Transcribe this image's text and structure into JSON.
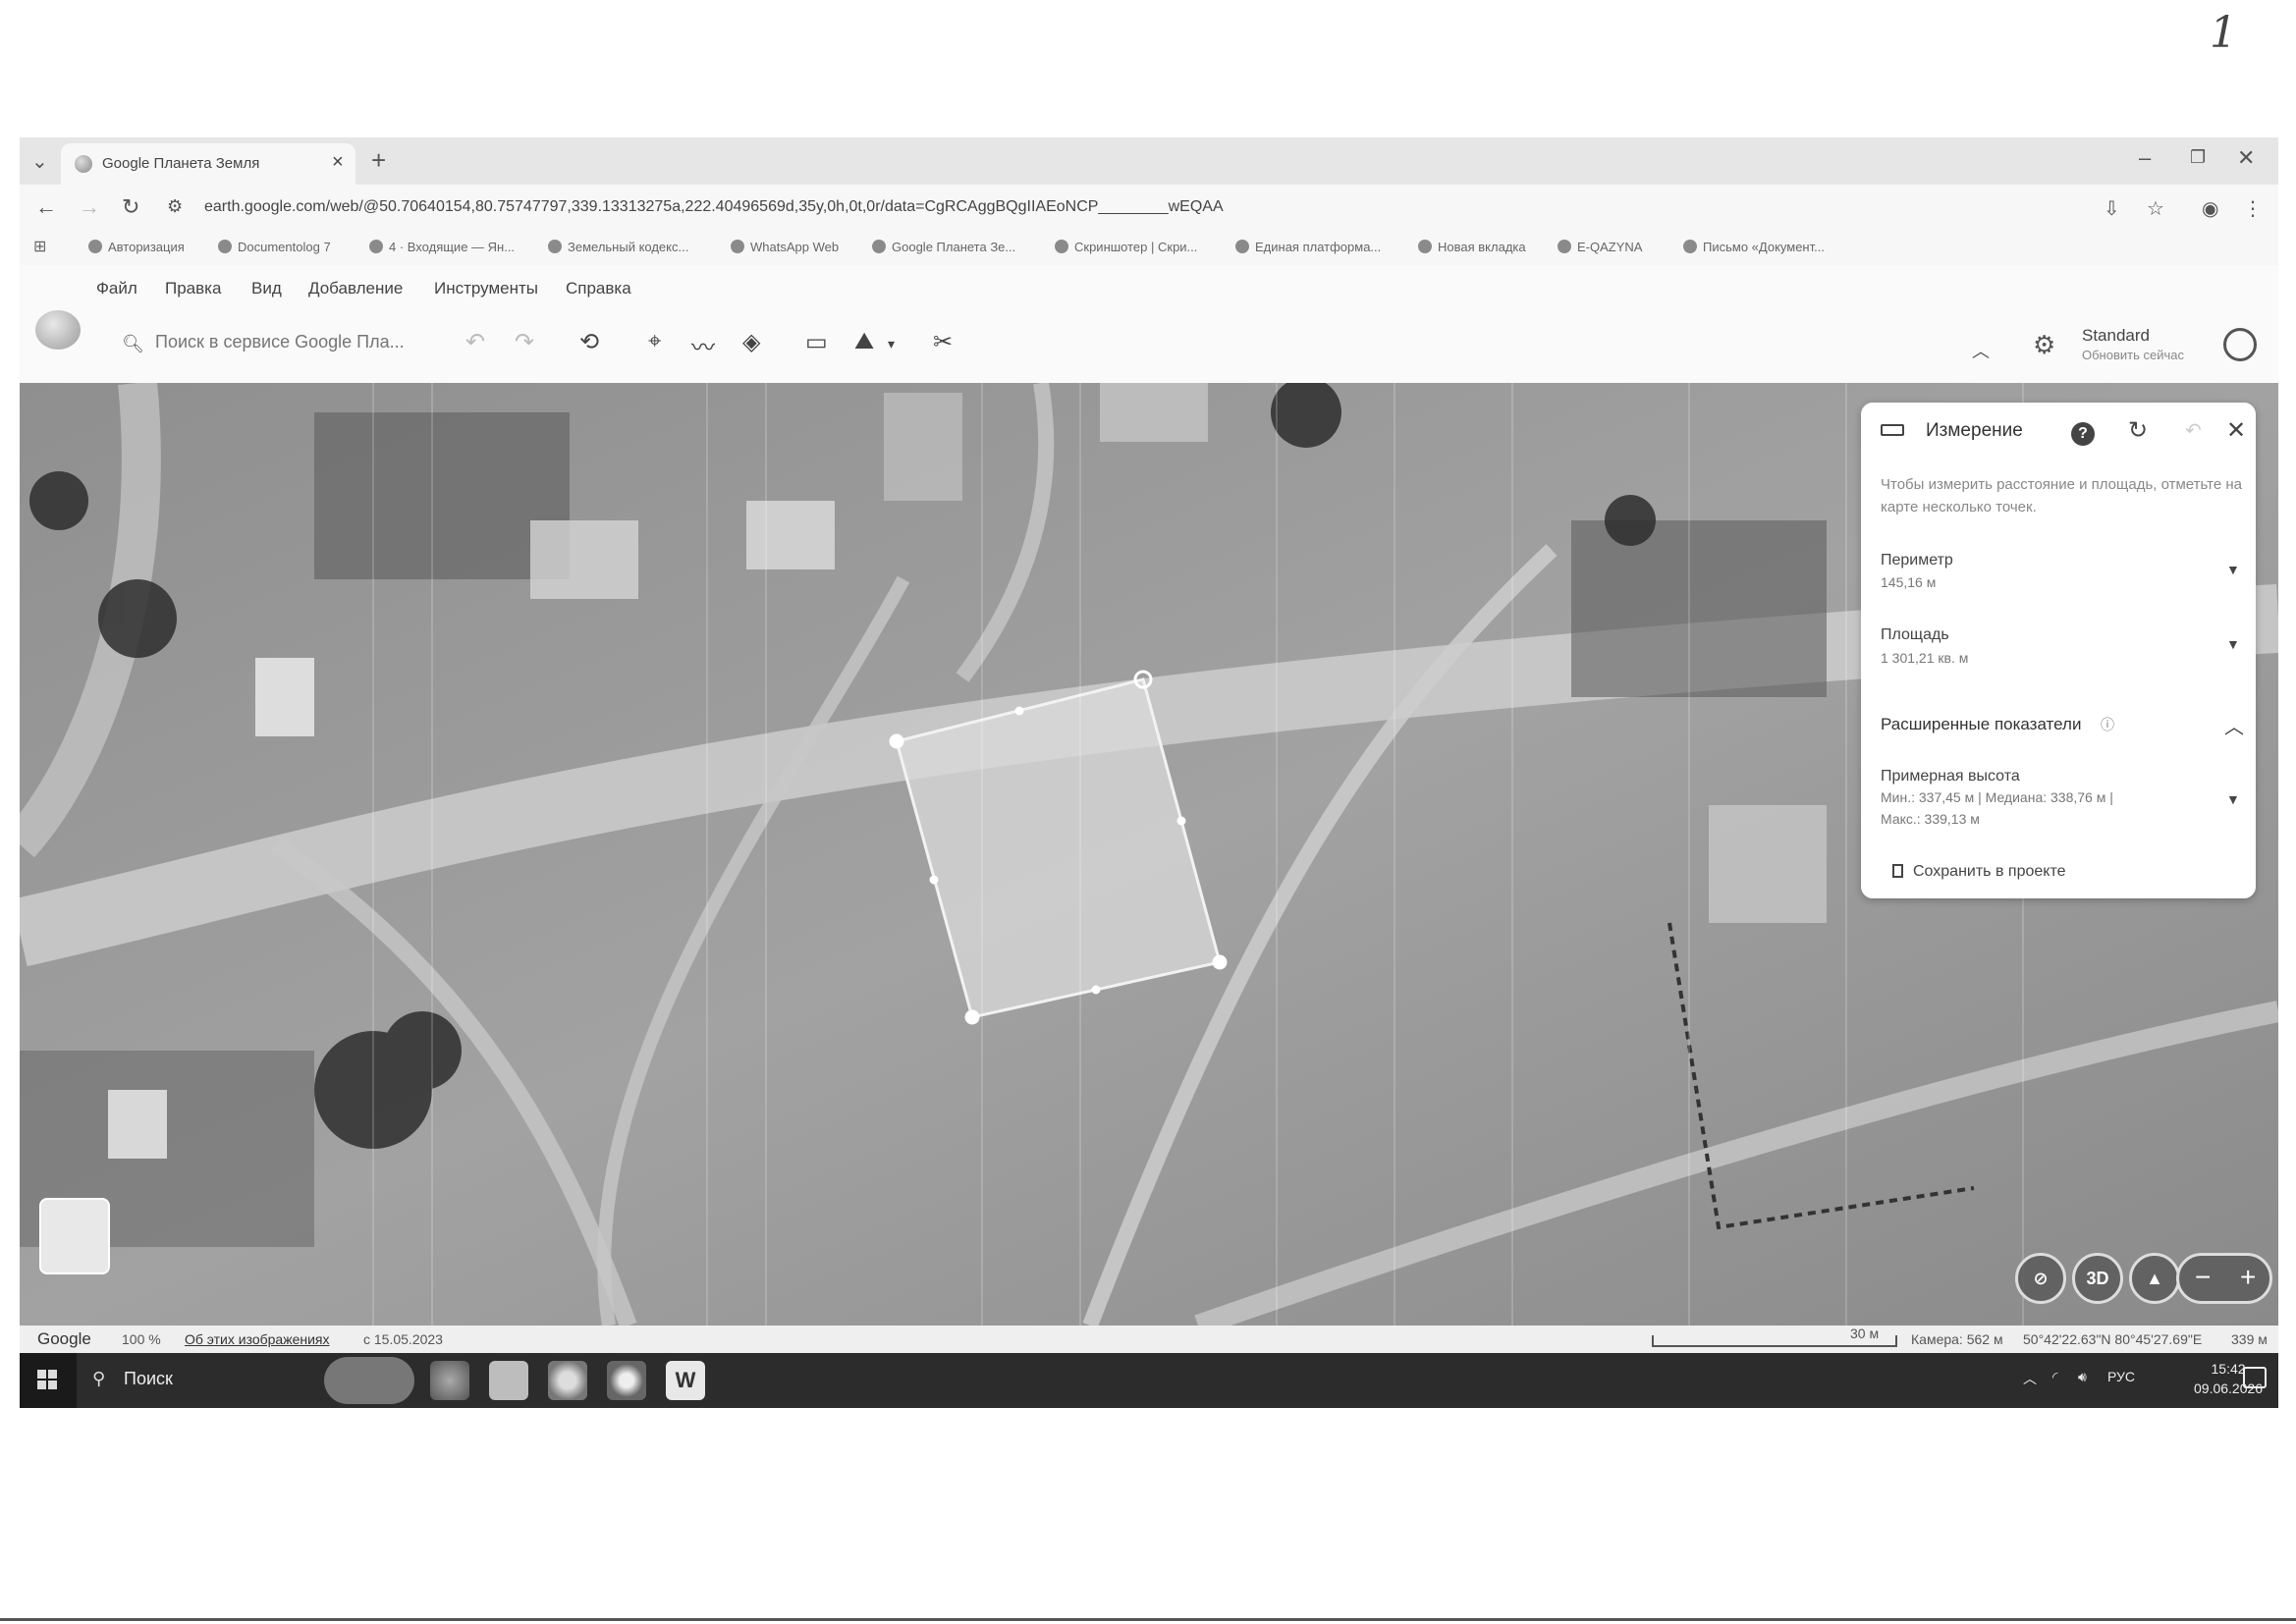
{
  "page_number": "1",
  "browser": {
    "tab_title": "Google Планета Земля",
    "url": "earth.google.com/web/@50.70640154,80.75747797,339.13313275a,222.40496569d,35y,0h,0t,0r/data=CgRCAggBQgIIAEoNCP________wEQAA",
    "bookmarks": [
      "Авторизация",
      "Documentolog 7",
      "4 · Входящие — Ян...",
      "Земельный кодекс...",
      "WhatsApp Web",
      "Google Планета Зе...",
      "Скриншотер | Скри...",
      "Единая платформа...",
      "Новая вкладка",
      "E-QAZYNA",
      "Письмо «Документ..."
    ]
  },
  "earth": {
    "menu": [
      "Файл",
      "Правка",
      "Вид",
      "Добавление",
      "Инструменты",
      "Справка"
    ],
    "search_placeholder": "Поиск в сервисе Google Пла...",
    "map_style": "Standard",
    "map_style_update": "Обновить сейчас"
  },
  "measurement": {
    "title": "Измерение",
    "hint": "Чтобы измерить расстояние и площадь, отметьте на карте несколько точек.",
    "perimeter_label": "Периметр",
    "perimeter_value": "145,16 м",
    "area_label": "Площадь",
    "area_value": "1 301,21 кв. м",
    "advanced_label": "Расширенные показатели",
    "height_label": "Примерная высота",
    "height_value_line1": "Мин.: 337,45 м | Медиана: 338,76 м |",
    "height_value_line2": "Макс.: 339,13 м",
    "save_label": "Сохранить в проекте"
  },
  "map_controls": {
    "view_3d": "3D"
  },
  "status": {
    "logo": "Google",
    "zoom": "100 %",
    "about_images": "Об этих изображениях",
    "imagery_date": "с 15.05.2023",
    "scale_label": "30 м",
    "camera": "Камера: 562 м",
    "coordinates": "50°42'22.63\"N 80°45'27.69\"E",
    "elevation": "339 м"
  },
  "taskbar": {
    "search_label": "Поиск",
    "language": "РУС",
    "time": "15:42",
    "date": "09.06.2026"
  }
}
